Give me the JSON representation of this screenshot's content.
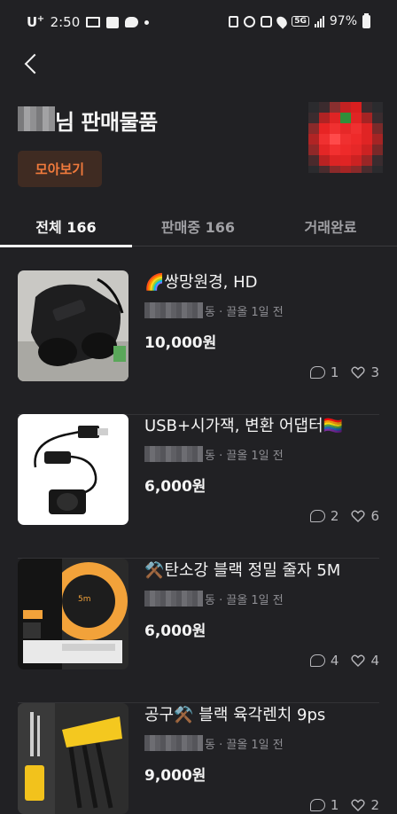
{
  "status_bar": {
    "carrier": "U",
    "carrier_sup": "+",
    "time": "2:50",
    "battery": "97%"
  },
  "header": {
    "title_suffix": "님 판매물품",
    "collect_button": "모아보기"
  },
  "tabs": [
    {
      "label": "전체 166",
      "active": true
    },
    {
      "label": "판매중 166",
      "active": false
    },
    {
      "label": "거래완료",
      "active": false
    }
  ],
  "products": [
    {
      "title": "🌈쌍망원경, HD",
      "meta": "동 · 끌올 1일 전",
      "price": "10,000원",
      "chats": "1",
      "likes": "3"
    },
    {
      "title": "USB+시가잭, 변환 어댑터🏳️‍🌈",
      "meta": "동 · 끌올 1일 전",
      "price": "6,000원",
      "chats": "2",
      "likes": "6"
    },
    {
      "title": "⚒️탄소강 블랙 정밀 줄자 5M",
      "meta": "동 · 끌올 1일 전",
      "price": "6,000원",
      "chats": "4",
      "likes": "4"
    },
    {
      "title": "공구⚒️ 블랙 육각렌치 9ps",
      "meta": "동 · 끌올 1일 전",
      "price": "9,000원",
      "chats": "1",
      "likes": "2"
    }
  ],
  "colors": {
    "background": "#212124",
    "accent": "#f07a3c",
    "accent_bg": "#3f2b22"
  },
  "icons": [
    "back-arrow-icon",
    "chat-icon",
    "heart-icon"
  ]
}
